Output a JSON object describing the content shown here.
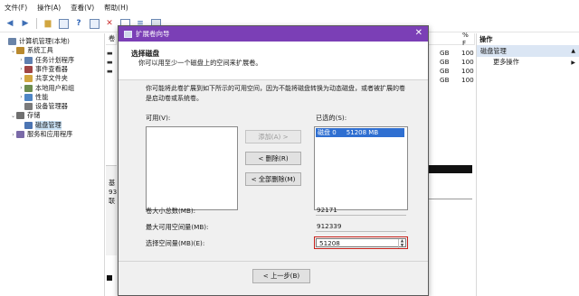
{
  "menubar": [
    "文件(F)",
    "操作(A)",
    "查看(V)",
    "帮助(H)"
  ],
  "toolbar_icons": [
    "back-arrow-icon",
    "forward-arrow-icon",
    "folder-icon",
    "grid-icon",
    "help-icon",
    "panel-icon",
    "delete-icon",
    "properties-icon",
    "list-icon",
    "disk-icon"
  ],
  "tree": [
    {
      "label": "计算机管理(本地)",
      "indent": 0,
      "arrow": "",
      "icon": "#6a84a8"
    },
    {
      "label": "系统工具",
      "indent": 1,
      "arrow": "⌄",
      "icon": "#b9892e"
    },
    {
      "label": "任务计划程序",
      "indent": 2,
      "arrow": "›",
      "icon": "#5e7fb0"
    },
    {
      "label": "事件查看器",
      "indent": 2,
      "arrow": "›",
      "icon": "#a04545"
    },
    {
      "label": "共享文件夹",
      "indent": 2,
      "arrow": "›",
      "icon": "#d1a640"
    },
    {
      "label": "本地用户和组",
      "indent": 2,
      "arrow": "›",
      "icon": "#6d8d4f"
    },
    {
      "label": "性能",
      "indent": 2,
      "arrow": "›",
      "icon": "#4f86c5"
    },
    {
      "label": "设备管理器",
      "indent": 2,
      "arrow": "",
      "icon": "#7b7b7b"
    },
    {
      "label": "存储",
      "indent": 1,
      "arrow": "⌄",
      "icon": "#6f6f6f"
    },
    {
      "label": "磁盘管理",
      "indent": 2,
      "arrow": "",
      "icon": "#4c75b3",
      "selected": true
    },
    {
      "label": "服务和应用程序",
      "indent": 1,
      "arrow": "›",
      "icon": "#7a6aa8"
    }
  ],
  "columns": {
    "vol": "卷",
    "pct": "% 可",
    "pct_short": "% F"
  },
  "bg_right_values": [
    "GB",
    "GB",
    "GB",
    "GB"
  ],
  "bg_pct_values": [
    "100",
    "100",
    "100",
    "100"
  ],
  "bg_small_texts": [
    "基",
    "93",
    "联"
  ],
  "actions": {
    "header": "操作",
    "selected": "磁盘管理",
    "item": "更多操作"
  },
  "wizard": {
    "title": "扩展卷向导",
    "header_title": "选择磁盘",
    "header_subtitle": "你可以用至少一个磁盘上的空间来扩展卷。",
    "description": "你可能将此卷扩展到如下所示的可用空间，因为不能将磁盘转换为动态磁盘，或者被扩展的卷是启动卷或系统卷。",
    "available_label": "可用(V):",
    "selected_label": "已选的(S):",
    "selected_item": "磁盘 0     51208 MB",
    "buttons": {
      "add": "添加(A) >",
      "remove": "< 删除(R)",
      "remove_all": "< 全部删除(M)",
      "back": "< 上一步(B)"
    },
    "fields": {
      "total_label": "卷大小总数(MB):",
      "total_value": "92171",
      "max_label": "最大可用空间量(MB):",
      "max_value": "912339",
      "select_label": "选择空间量(MB)(E):",
      "select_value": "51208"
    }
  }
}
